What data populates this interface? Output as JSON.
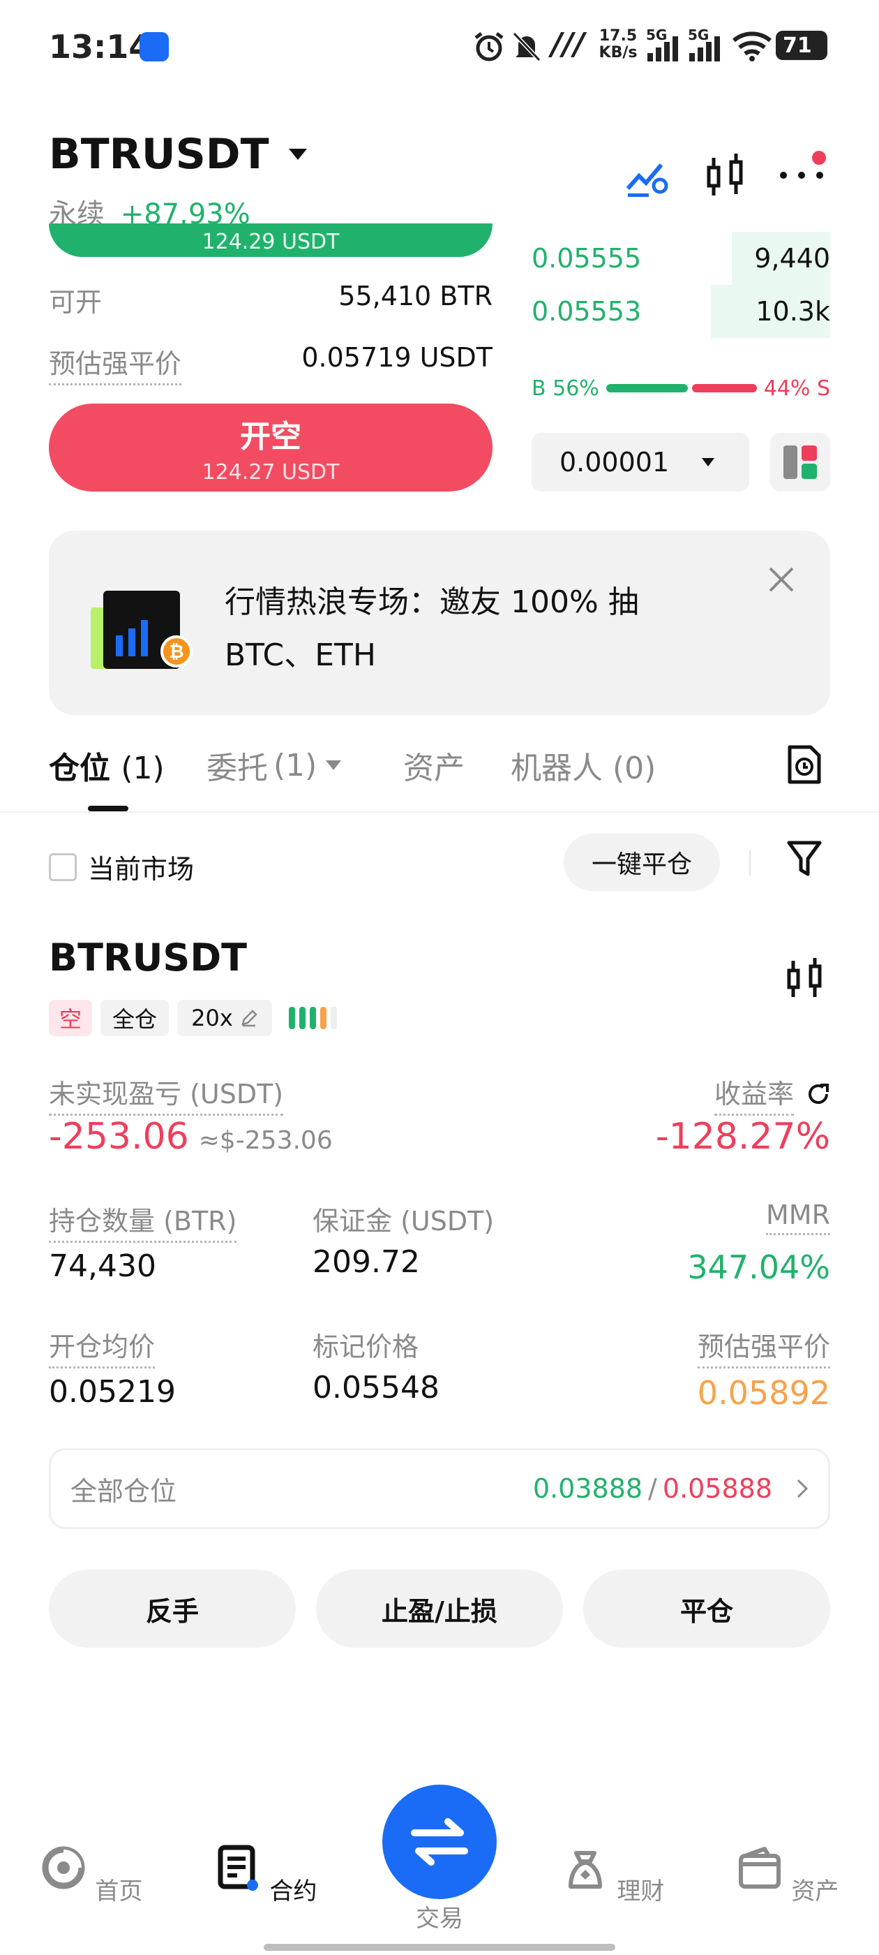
{
  "status_bar": {
    "time": "13:14",
    "net_speed_value": "17.5",
    "net_speed_unit": "KB/s",
    "signal1": "5G",
    "signal2": "5G",
    "battery": "71"
  },
  "header": {
    "symbol": "BTRUSDT",
    "contract_type": "永续",
    "change": "+87.93%"
  },
  "order_form": {
    "top_button_amount": "124.29 USDT",
    "available_label": "可开",
    "available_value": "55,410 BTR",
    "liq_label": "预估强平价",
    "liq_value": "0.05719 USDT",
    "short_button_label": "开空",
    "short_button_amount": "124.27 USDT"
  },
  "orderbook": {
    "rows": [
      {
        "price": "0.05555",
        "qty": "9,440",
        "depth": 0.33
      },
      {
        "price": "0.05553",
        "qty": "10.3k",
        "depth": 0.4
      }
    ],
    "buy_ratio": "B 56%",
    "sell_ratio": "44% S",
    "buy_fraction": 0.56,
    "tick_size": "0.00001"
  },
  "banner": {
    "text_line1": "行情热浪专场：邀友 100% 抽",
    "text_line2": "BTC、ETH"
  },
  "tabs": {
    "positions": "仓位",
    "positions_count": "(1)",
    "orders": "委托",
    "orders_count": "(1)",
    "assets": "资产",
    "bots": "机器人",
    "bots_count": "(0)"
  },
  "filter": {
    "current_market_label": "当前市场",
    "close_all_label": "一键平仓"
  },
  "position": {
    "symbol": "BTRUSDT",
    "side_tag": "空",
    "margin_mode_tag": "全仓",
    "leverage_tag": "20x",
    "unrealized_label": "未实现盈亏 (USDT)",
    "unrealized_value": "-253.06",
    "unrealized_usd": "≈$-253.06",
    "roi_label": "收益率",
    "roi_value": "-128.27%",
    "qty_label": "持仓数量 (BTR)",
    "qty_value": "74,430",
    "margin_label": "保证金 (USDT)",
    "margin_value": "209.72",
    "mmr_label": "MMR",
    "mmr_value": "347.04%",
    "entry_label": "开仓均价",
    "entry_value": "0.05219",
    "mark_label": "标记价格",
    "mark_value": "0.05548",
    "liq_label": "预估强平价",
    "liq_value": "0.05892",
    "all_pos_label": "全部仓位",
    "tp_value": "0.03888",
    "sl_value": "0.05888",
    "sep": "/"
  },
  "actions": {
    "reverse": "反手",
    "tpsl": "止盈/止损",
    "close": "平仓"
  },
  "bottom_nav": {
    "home": "首页",
    "futures": "合约",
    "trade": "交易",
    "finance": "理财",
    "assets": "资产"
  },
  "colors": {
    "green": "#20b26c",
    "red": "#ef3e5c",
    "orange": "#f7a24b",
    "blue": "#1a6cf6"
  }
}
